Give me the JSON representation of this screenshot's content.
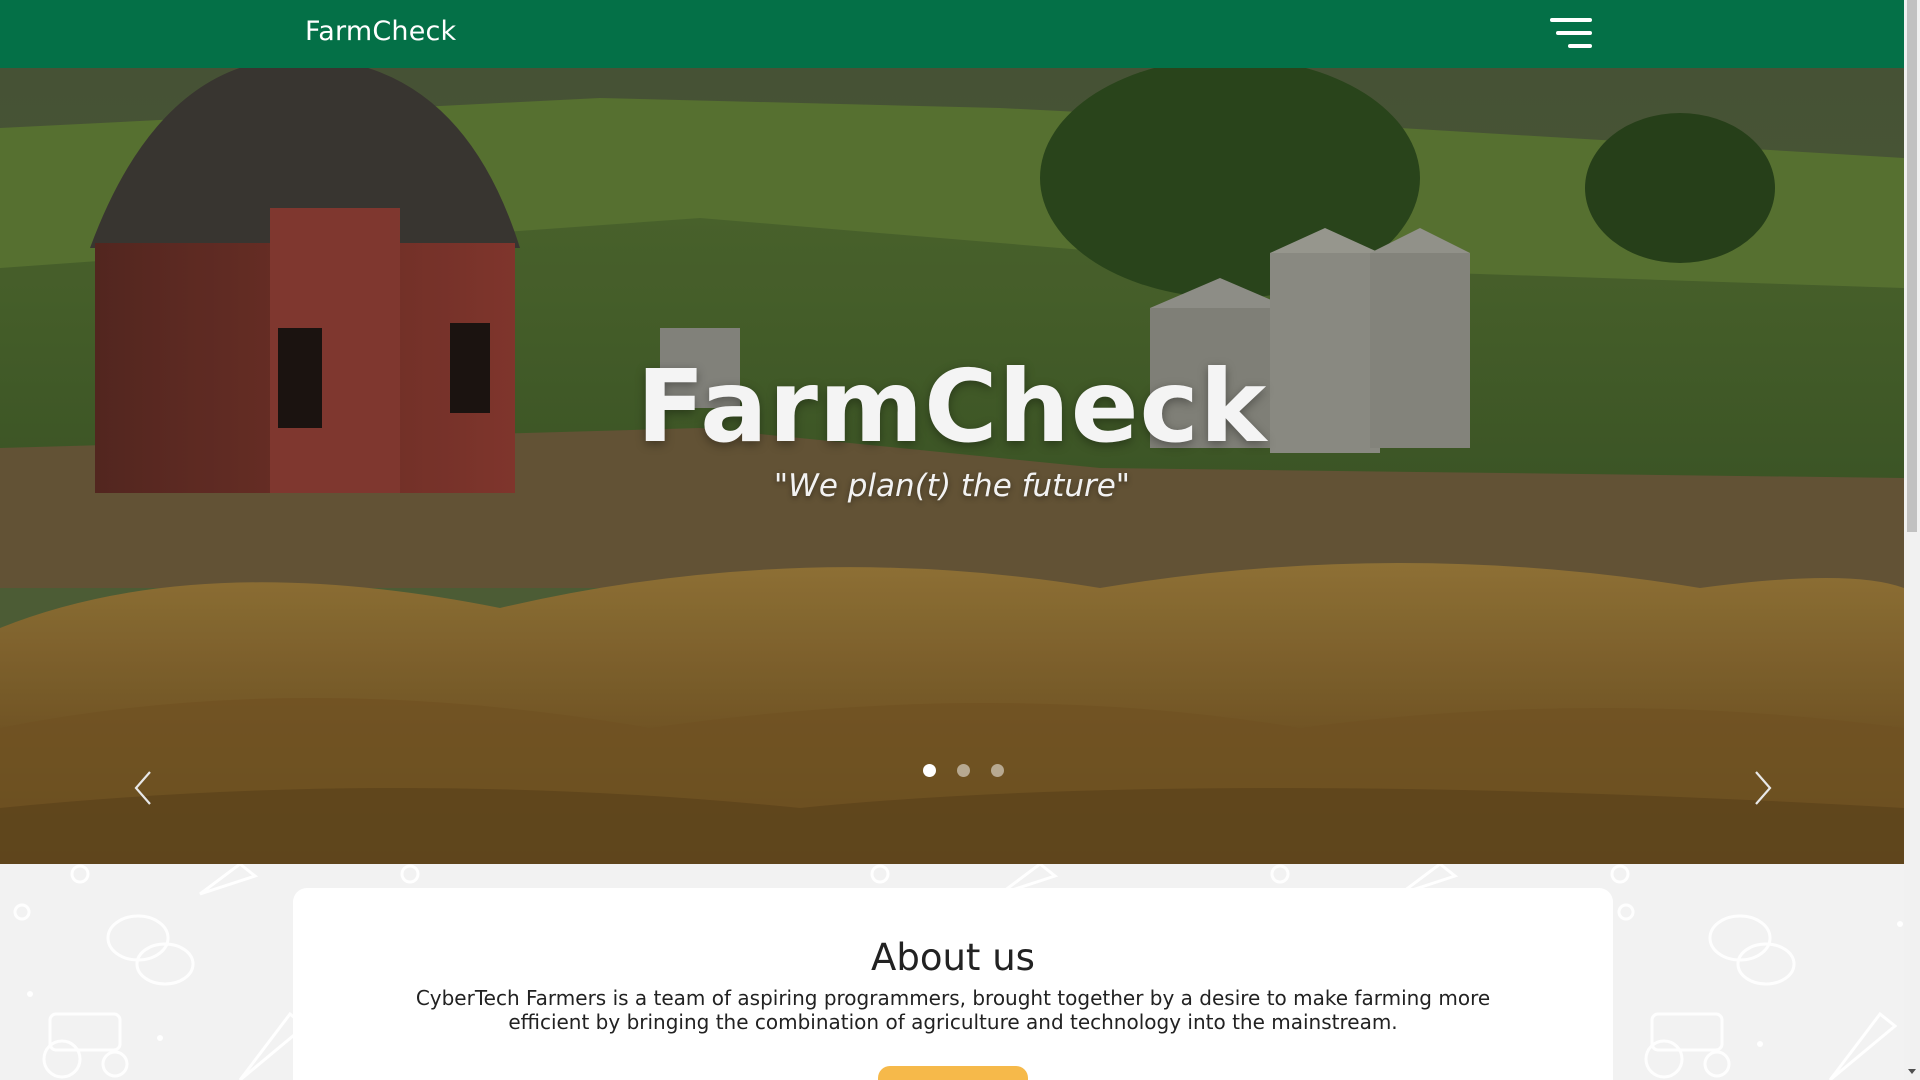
{
  "navbar": {
    "brand": "FarmCheck",
    "menu_icon": "hamburger-menu-icon",
    "background_color": "#047047"
  },
  "hero": {
    "title": "FarmCheck",
    "tagline": "\"We plan(t) the future\"",
    "slide_count": 3,
    "active_slide": 1,
    "prev_icon": "chevron-left-icon",
    "next_icon": "chevron-right-icon",
    "image_description_icon": "farm-landscape-image"
  },
  "about": {
    "title": "About us",
    "text": "CyberTech Farmers is a team of aspiring programmers, brought together by a desire to make farming more efficient by bringing the combination of agriculture and technology into the mainstream.",
    "button_color": "#f6b94a"
  },
  "pattern_icons": [
    "carrot-icon",
    "gear-icon",
    "chat-bubbles-icon",
    "tractor-icon"
  ]
}
